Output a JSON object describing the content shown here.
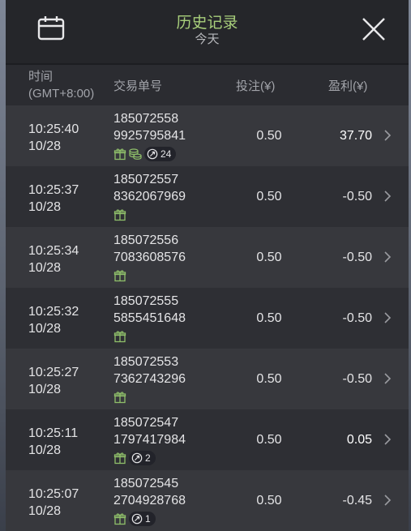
{
  "header": {
    "title": "历史记录",
    "subtitle": "今天",
    "left_icon": "calendar-icon",
    "right_icon": "close-icon"
  },
  "columns": {
    "time": "时间",
    "timezone": "(GMT+8:00)",
    "order": "交易单号",
    "bet": "投注(¥)",
    "profit": "盈利(¥)"
  },
  "rows": [
    {
      "time": "10:25:40",
      "date": "10/28",
      "order_a": "185072558",
      "order_b": "9925795841",
      "bet": "0.50",
      "profit": "37.70",
      "win": true,
      "gift": true,
      "coins": true,
      "badge": "24"
    },
    {
      "time": "10:25:37",
      "date": "10/28",
      "order_a": "185072557",
      "order_b": "8362067969",
      "bet": "0.50",
      "profit": "-0.50",
      "win": false,
      "gift": true,
      "coins": false,
      "badge": ""
    },
    {
      "time": "10:25:34",
      "date": "10/28",
      "order_a": "185072556",
      "order_b": "7083608576",
      "bet": "0.50",
      "profit": "-0.50",
      "win": false,
      "gift": true,
      "coins": false,
      "badge": ""
    },
    {
      "time": "10:25:32",
      "date": "10/28",
      "order_a": "185072555",
      "order_b": "5855451648",
      "bet": "0.50",
      "profit": "-0.50",
      "win": false,
      "gift": true,
      "coins": false,
      "badge": ""
    },
    {
      "time": "10:25:27",
      "date": "10/28",
      "order_a": "185072553",
      "order_b": "7362743296",
      "bet": "0.50",
      "profit": "-0.50",
      "win": false,
      "gift": true,
      "coins": false,
      "badge": ""
    },
    {
      "time": "10:25:11",
      "date": "10/28",
      "order_a": "185072547",
      "order_b": "1797417984",
      "bet": "0.50",
      "profit": "0.05",
      "win": true,
      "gift": true,
      "coins": false,
      "badge": "2"
    },
    {
      "time": "10:25:07",
      "date": "10/28",
      "order_a": "185072545",
      "order_b": "2704928768",
      "bet": "0.50",
      "profit": "-0.45",
      "win": false,
      "gift": true,
      "coins": false,
      "badge": "1"
    }
  ],
  "colors": {
    "title_accent": "#a8cf7b",
    "icon_green": "#8fbf6a",
    "row_odd": "#37383d",
    "row_even": "#2e2f34"
  }
}
